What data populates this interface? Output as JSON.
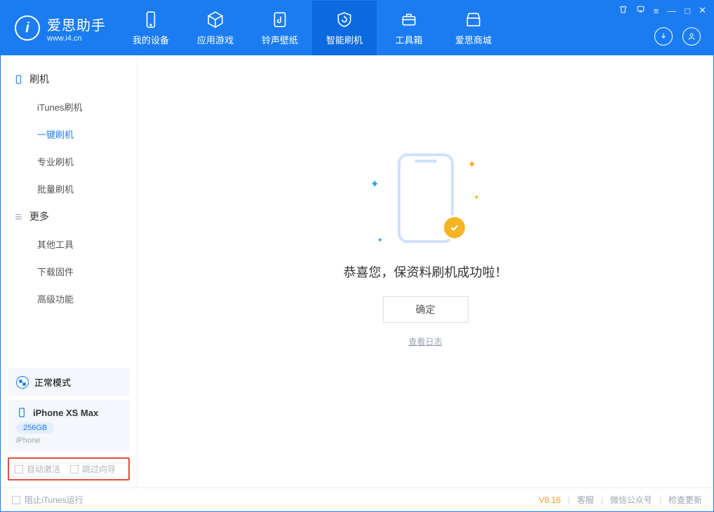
{
  "app": {
    "name_cn": "爱思助手",
    "url": "www.i4.cn"
  },
  "tabs": {
    "device": "我的设备",
    "apps": "应用游戏",
    "ringtone": "铃声壁纸",
    "flash": "智能刷机",
    "toolbox": "工具箱",
    "store": "爱思商城"
  },
  "sidebar": {
    "group_flash": "刷机",
    "group_more": "更多",
    "items": {
      "itunes_flash": "iTunes刷机",
      "one_click": "一键刷机",
      "pro_flash": "专业刷机",
      "batch_flash": "批量刷机",
      "other_tools": "其他工具",
      "download_fw": "下载固件",
      "advanced": "高级功能"
    },
    "mode_label": "正常模式",
    "device": {
      "name": "iPhone XS Max",
      "storage": "256GB",
      "type": "iPhone"
    },
    "options": {
      "auto_activate": "自动激活",
      "skip_guide": "跳过向导"
    }
  },
  "main": {
    "success_text": "恭喜您，保资料刷机成功啦！",
    "ok_button": "确定",
    "view_log": "查看日志"
  },
  "footer": {
    "block_itunes": "阻止iTunes运行",
    "version": "V8.16",
    "support": "客服",
    "wechat": "微信公众号",
    "check_update": "检查更新"
  }
}
